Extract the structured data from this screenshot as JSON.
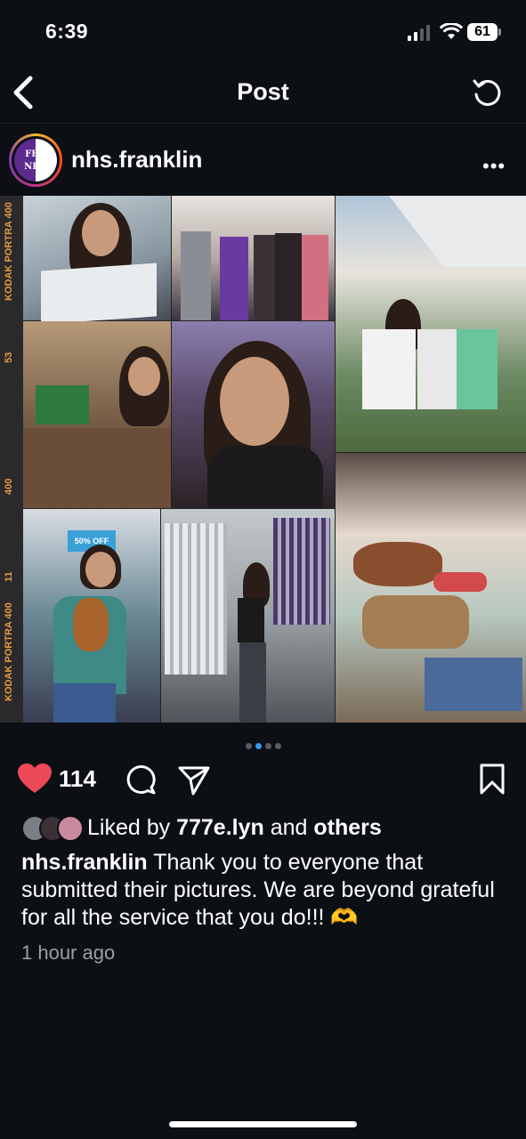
{
  "status_bar": {
    "time": "6:39",
    "battery": "61"
  },
  "nav": {
    "title": "Post"
  },
  "author": {
    "username": "nhs.franklin",
    "avatar_text_top": "FHS",
    "avatar_text_bottom": "NHS"
  },
  "photo": {
    "film_labels": [
      "KODAK PORTRA 400",
      "53",
      "400",
      "11",
      "KODAK PORTRA 400"
    ],
    "sign_text": "50% OFF",
    "page_index": 2,
    "page_count": 4
  },
  "actions": {
    "likes": "114"
  },
  "liked_by": {
    "prefix": "Liked by",
    "user": "777e.lyn",
    "joiner": "and",
    "others": "others"
  },
  "caption": {
    "username": "nhs.franklin",
    "text": "Thank you to everyone that submitted their pictures. We are beyond grateful for all the service that you do!!! 🫶"
  },
  "timestamp": "1 hour ago",
  "icons": {
    "back": "chevron-left-icon",
    "refresh": "refresh-icon",
    "more": "more-icon",
    "like": "heart-icon",
    "comment": "comment-icon",
    "share": "send-icon",
    "save": "bookmark-icon"
  },
  "colors": {
    "like": "#ed4956",
    "active_dot": "#3897f0",
    "background": "#0c0f14"
  }
}
